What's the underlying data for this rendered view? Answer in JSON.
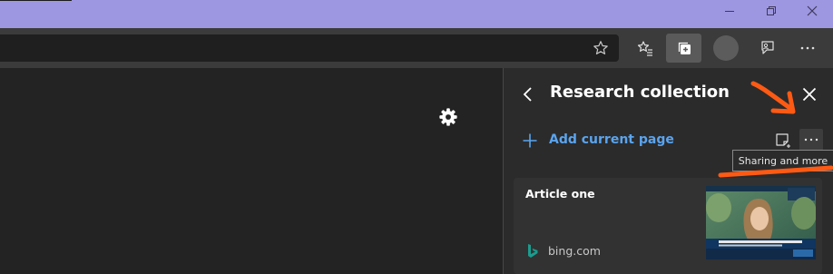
{
  "collections_panel": {
    "title": "Research collection",
    "add_current_page_label": "Add current page",
    "tooltip": "Sharing and more"
  },
  "article_card": {
    "title": "Article one",
    "source": "bing.com"
  },
  "colors": {
    "title_bar": "#9d97e2",
    "toolbar": "#3b3b3b",
    "panel": "#2b2b2b",
    "accent_link": "#5aa4ef",
    "annotation": "#ff5a14"
  }
}
